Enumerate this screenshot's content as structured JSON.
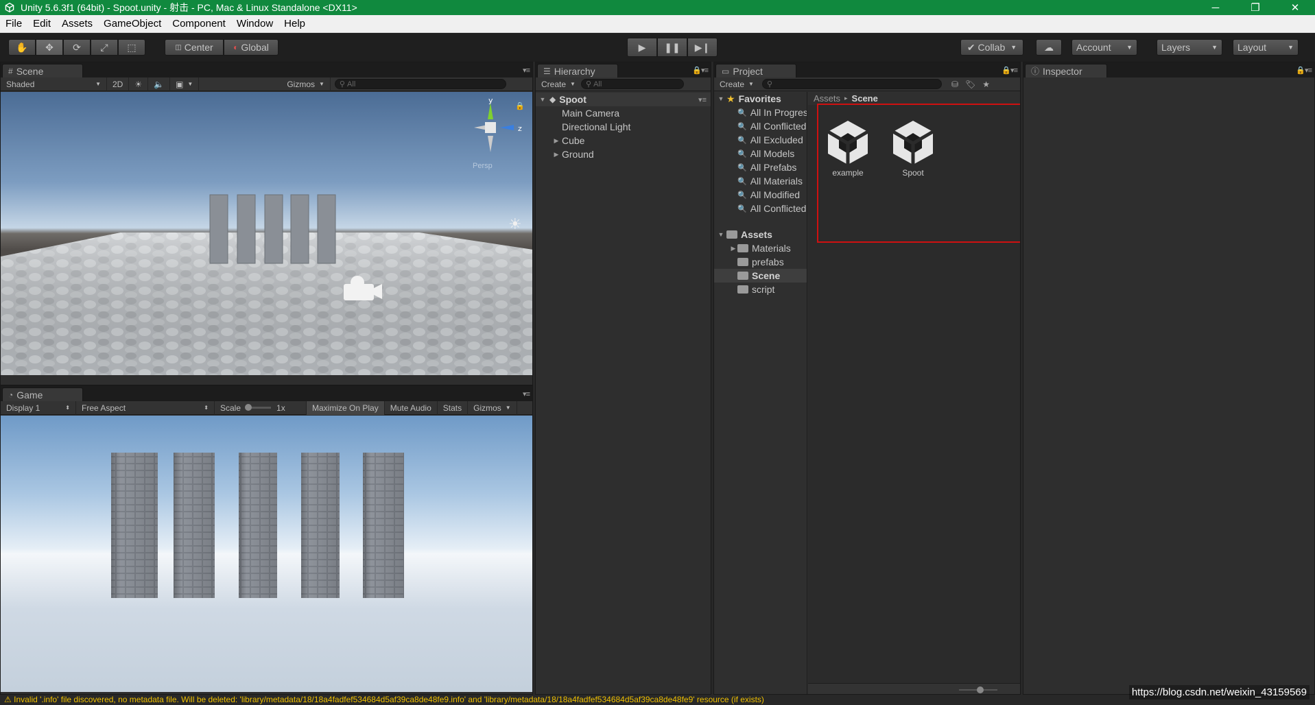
{
  "window": {
    "title": "Unity 5.6.3f1 (64bit) - Spoot.unity - 射击 - PC, Mac & Linux Standalone <DX11>",
    "minimize": "─",
    "restore": "❐",
    "close": "✕",
    "title_bar_color": "#10893e"
  },
  "menu": [
    "File",
    "Edit",
    "Assets",
    "GameObject",
    "Component",
    "Window",
    "Help"
  ],
  "toolbar": {
    "tools": [
      "hand-icon",
      "move-icon",
      "rotate-icon",
      "scale-icon",
      "rect-tool-icon"
    ],
    "pivot": "Center",
    "space": "Global",
    "collab": "Collab",
    "account": "Account",
    "layers": "Layers",
    "layout": "Layout"
  },
  "scene": {
    "tab": "Scene",
    "shading": "Shaded",
    "mode_2d": "2D",
    "gizmos": "Gizmos",
    "search_placeholder": "All",
    "axis_y": "y",
    "axis_z": "z",
    "persp": "Persp"
  },
  "game": {
    "tab": "Game",
    "display": "Display 1",
    "aspect": "Free Aspect",
    "scale_label": "Scale",
    "scale_value": "1x",
    "maximize": "Maximize On Play",
    "mute": "Mute Audio",
    "stats": "Stats",
    "gizmos": "Gizmos"
  },
  "hierarchy": {
    "tab": "Hierarchy",
    "create": "Create",
    "search_placeholder": "All",
    "root": "Spoot",
    "items": [
      {
        "label": "Main Camera",
        "expandable": false
      },
      {
        "label": "Directional Light",
        "expandable": false
      },
      {
        "label": "Cube",
        "expandable": true
      },
      {
        "label": "Ground",
        "expandable": true
      }
    ]
  },
  "project": {
    "tab": "Project",
    "create": "Create",
    "favorites_label": "Favorites",
    "favorites": [
      "All In Progress",
      "All Conflicted",
      "All Excluded",
      "All Models",
      "All Prefabs",
      "All Materials",
      "All Modified",
      "All Conflicted"
    ],
    "assets_label": "Assets",
    "folders": [
      "Materials",
      "prefabs",
      "Scene",
      "script"
    ],
    "selected_folder": "Scene",
    "breadcrumb": [
      "Assets",
      "Scene"
    ],
    "breadcrumb_sep": "▸",
    "files": [
      "example",
      "Spoot"
    ],
    "highlight_color": "#d01010"
  },
  "inspector": {
    "tab": "Inspector"
  },
  "status": {
    "message": "Invalid '.info' file discovered, no metadata file. Will be deleted: 'library/metadata/18/18a4fadfef534684d5af39ca8de48fe9.info' and 'library/metadata/18/18a4fadfef534684d5af39ca8de48fe9' resource (if exists)"
  },
  "watermark": "https://blog.csdn.net/weixin_43159569"
}
